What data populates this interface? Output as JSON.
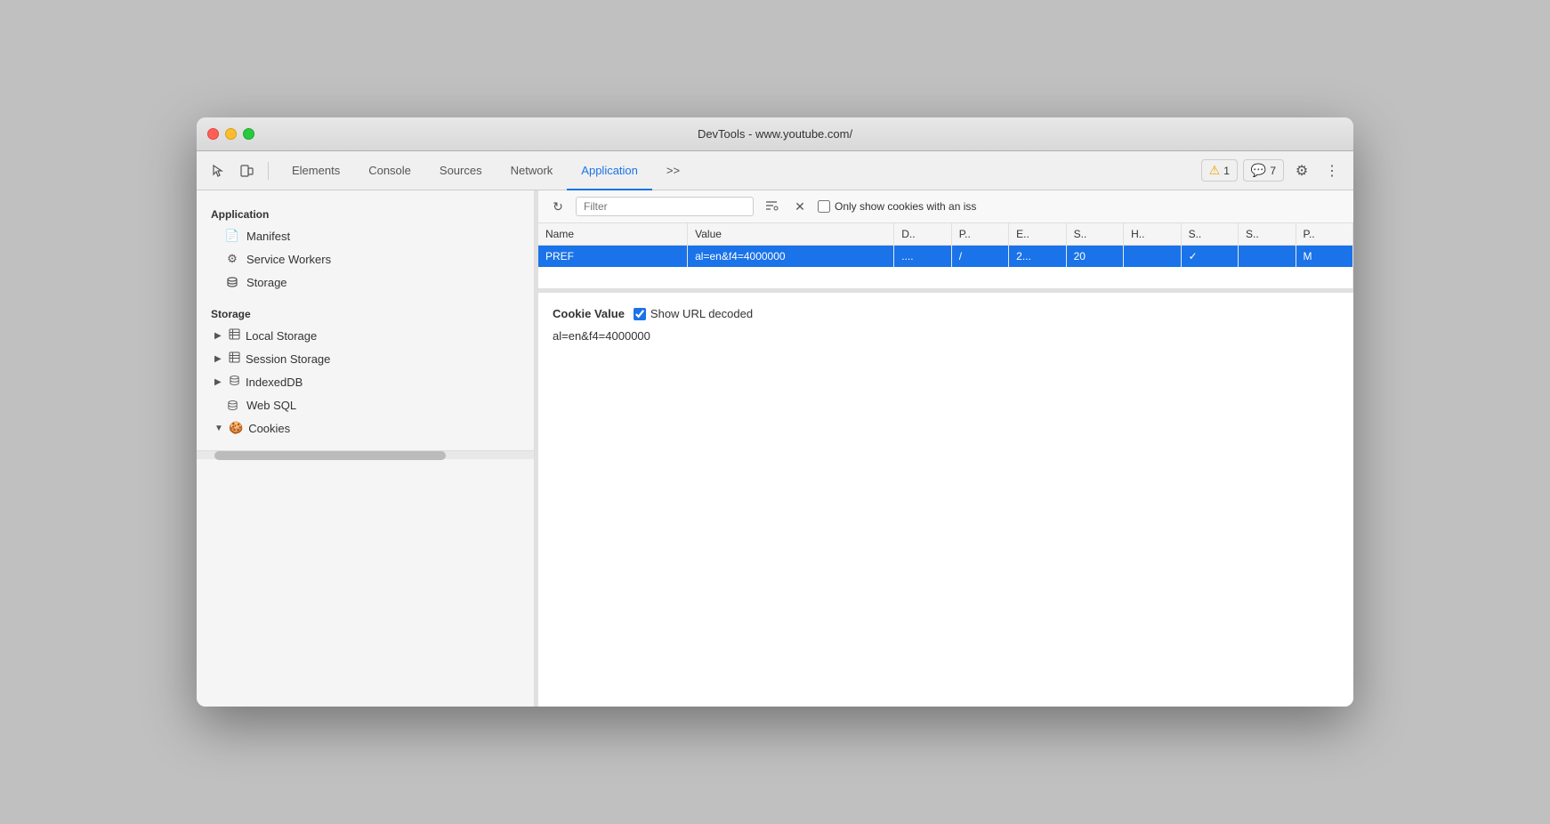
{
  "window": {
    "title": "DevTools - www.youtube.com/"
  },
  "toolbar": {
    "tabs": [
      {
        "id": "elements",
        "label": "Elements",
        "active": false
      },
      {
        "id": "console",
        "label": "Console",
        "active": false
      },
      {
        "id": "sources",
        "label": "Sources",
        "active": false
      },
      {
        "id": "network",
        "label": "Network",
        "active": false
      },
      {
        "id": "application",
        "label": "Application",
        "active": true
      }
    ],
    "warning_count": "1",
    "chat_count": "7",
    "more_tabs_label": ">>"
  },
  "sidebar": {
    "app_section_title": "Application",
    "app_items": [
      {
        "label": "Manifest",
        "icon": "📄"
      },
      {
        "label": "Service Workers",
        "icon": "⚙"
      },
      {
        "label": "Storage",
        "icon": "🗄"
      }
    ],
    "storage_section_title": "Storage",
    "storage_items": [
      {
        "label": "Local Storage",
        "expandable": true,
        "expanded": false
      },
      {
        "label": "Session Storage",
        "expandable": true,
        "expanded": false
      },
      {
        "label": "IndexedDB",
        "expandable": true,
        "expanded": false
      },
      {
        "label": "Web SQL",
        "expandable": false
      },
      {
        "label": "Cookies",
        "expandable": true,
        "expanded": true
      }
    ]
  },
  "panel": {
    "filter_placeholder": "Filter",
    "only_issues_label": "Only show cookies with an iss",
    "table": {
      "columns": [
        "Name",
        "Value",
        "D..",
        "P..",
        "E..",
        "S..",
        "H..",
        "S..",
        "S..",
        "P.."
      ],
      "rows": [
        {
          "name": "PREF",
          "value": "al=en&f4=4000000",
          "domain": "....",
          "path": "/",
          "expires": "2...",
          "size": "20",
          "httponly": "",
          "secure": "✓",
          "samesite": "",
          "priority": "M",
          "selected": true
        }
      ]
    },
    "cookie_value_label": "Cookie Value",
    "show_url_decoded_label": "Show URL decoded",
    "show_url_decoded_checked": true,
    "cookie_value_text": "al=en&f4=4000000"
  }
}
